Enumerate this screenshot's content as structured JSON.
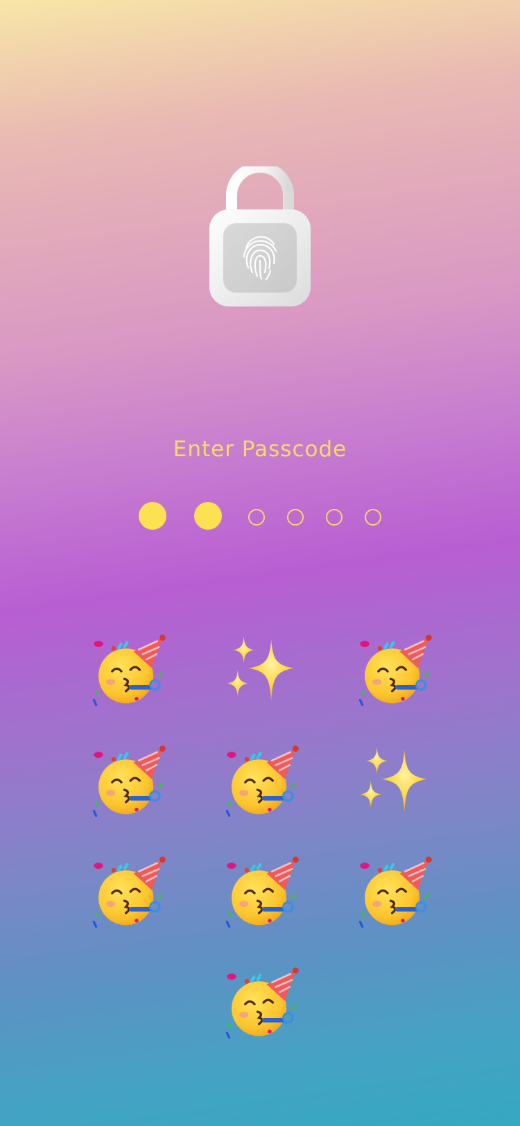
{
  "prompt": {
    "title": "Enter Passcode"
  },
  "passcode": {
    "length": 6,
    "entered": 2
  },
  "keypad": {
    "keys": [
      {
        "icon": "partying-face-emoji-icon"
      },
      {
        "icon": "sparkles-emoji-icon"
      },
      {
        "icon": "partying-face-emoji-icon"
      },
      {
        "icon": "partying-face-emoji-icon"
      },
      {
        "icon": "partying-face-emoji-icon"
      },
      {
        "icon": "sparkles-emoji-icon"
      },
      {
        "icon": "partying-face-emoji-icon"
      },
      {
        "icon": "partying-face-emoji-icon"
      },
      {
        "icon": "partying-face-emoji-icon"
      },
      {
        "icon": "partying-face-emoji-icon"
      }
    ]
  },
  "colors": {
    "accent": "#fce152",
    "dot_outline": "#f6d867",
    "title": "#f4dc67",
    "lock": "#ffffff"
  }
}
